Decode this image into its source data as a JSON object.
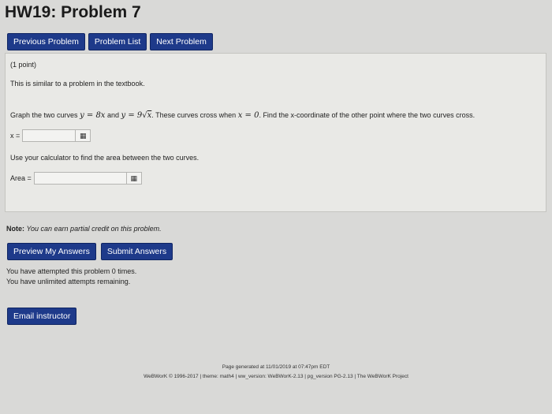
{
  "header": {
    "title": "HW19: Problem 7"
  },
  "nav": {
    "previous": "Previous Problem",
    "list": "Problem List",
    "next": "Next Problem"
  },
  "problem": {
    "points": "(1 point)",
    "similar": "This is similar to a problem in the textbook.",
    "graph_pre": "Graph the two curves",
    "curve1": "y = 8x",
    "and": "and",
    "curve2_lhs": "y = 9",
    "curve2_rad": "x",
    "graph_mid": ". These curves cross when",
    "cross": "x = 0",
    "graph_post": ". Find the x-coordinate of the other point where the two curves cross.",
    "x_label": "x =",
    "x_value": "",
    "calc_text": "Use your calculator to find the area between the two curves.",
    "area_label": "Area =",
    "area_value": ""
  },
  "note": {
    "label": "Note:",
    "text": "You can earn partial credit on this problem."
  },
  "buttons": {
    "preview": "Preview My Answers",
    "submit": "Submit Answers",
    "email": "Email instructor"
  },
  "attempts": {
    "line1": "You have attempted this problem 0 times.",
    "line2": "You have unlimited attempts remaining."
  },
  "footer": {
    "generated": "Page generated at 11/01/2019 at 07:47pm EDT",
    "credits": "WeBWorK © 1996-2017 | theme: math4 | ww_version: WeBWorK-2.13 | pg_version PG-2.13 | The WeBWorK Project"
  },
  "icons": {
    "grid": "grid-icon"
  }
}
